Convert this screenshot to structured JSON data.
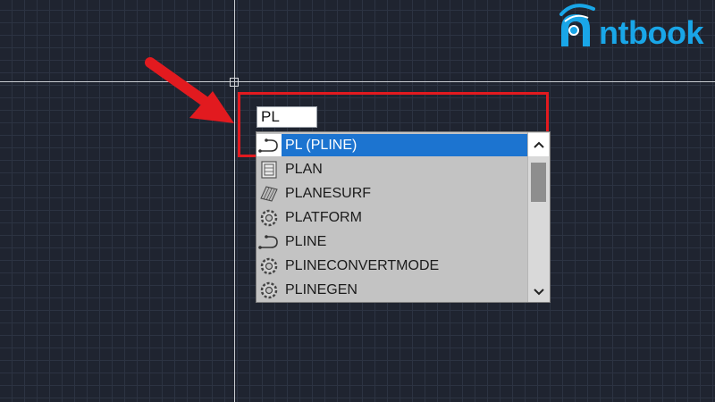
{
  "logo": {
    "text": "ntbook"
  },
  "command_line": {
    "value": "PL"
  },
  "autocomplete": {
    "items": [
      {
        "label": "PL (PLINE)",
        "icon": "polyline-icon",
        "selected": true
      },
      {
        "label": "PLAN",
        "icon": "plan-icon",
        "selected": false
      },
      {
        "label": "PLANESURF",
        "icon": "planar-surface-icon",
        "selected": false
      },
      {
        "label": "PLATFORM",
        "icon": "gear-icon",
        "selected": false
      },
      {
        "label": "PLINE",
        "icon": "polyline-icon",
        "selected": false
      },
      {
        "label": "PLINECONVERTMODE",
        "icon": "gear-icon",
        "selected": false
      },
      {
        "label": "PLINEGEN",
        "icon": "gear-icon",
        "selected": false
      }
    ]
  },
  "colors": {
    "background": "#1f2430",
    "highlight_border": "#e21a1f",
    "selection": "#1c74d0",
    "brand": "#19a6e8"
  }
}
